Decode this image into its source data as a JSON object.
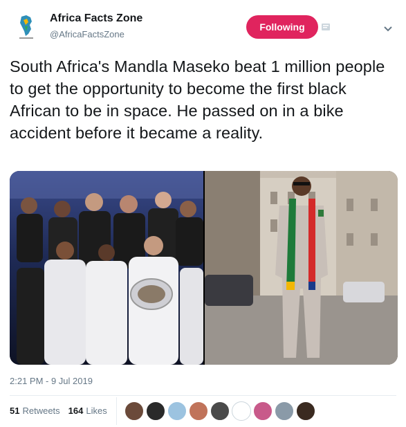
{
  "account": {
    "display_name": "Africa Facts Zone",
    "handle": "@AfricaFactsZone",
    "follow_label": "Following",
    "avatar_icon": "africa-map-logo-icon"
  },
  "tweet": {
    "text": "South Africa's Mandla Maseko beat 1 million people to get the opportunity to become the first black African to be in space. He passed on in a bike accident before it became a reality.",
    "timestamp": "2:21 PM - 9 Jul 2019"
  },
  "stats": {
    "retweets_count": "51",
    "retweets_label": "Retweets",
    "likes_count": "164",
    "likes_label": "Likes"
  },
  "liker_avatars": [
    {
      "color": "#6b4a3a"
    },
    {
      "color": "#2a2a2a"
    },
    {
      "color": "#9cc3e0"
    },
    {
      "color": "#c0735a"
    },
    {
      "color": "#4a4a4a"
    },
    {
      "color": "#ffffff"
    },
    {
      "color": "#c85a8a"
    },
    {
      "color": "#8a9aa8"
    },
    {
      "color": "#3a2a20"
    }
  ],
  "colors": {
    "accent": "#e0245e",
    "secondary_text": "#657786",
    "primary_text": "#14171a"
  }
}
